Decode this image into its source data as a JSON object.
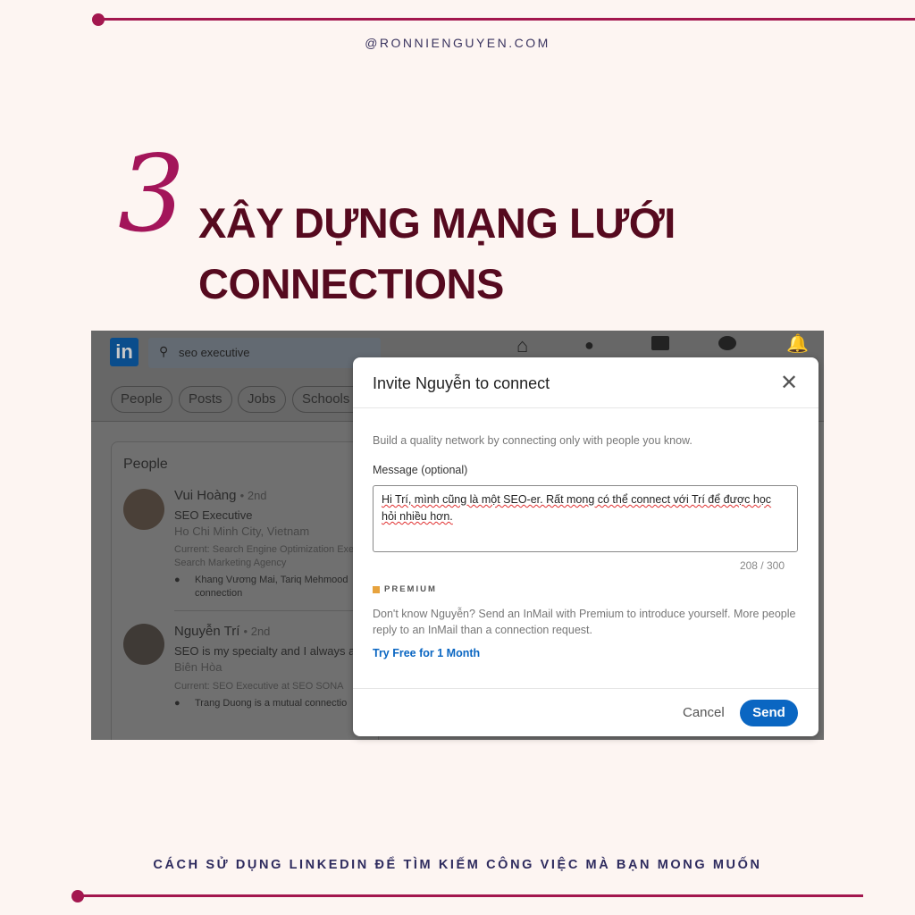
{
  "site": "@RONNIENGUYEN.COM",
  "step_number": "3",
  "title_line1": "XÂY DỰNG MẠNG LƯỚI",
  "title_line2": "CONNECTIONS",
  "footer": "CÁCH SỬ DỤNG LINKEDIN ĐỂ TÌM KIẾM CÔNG VIỆC MÀ BẠN MONG MUỐN",
  "colors": {
    "accent": "#a3174f",
    "title": "#560a1f",
    "linkedin_blue": "#0a66c2"
  },
  "linkedin": {
    "logo": "in",
    "search_value": "seo executive",
    "filters": [
      "People",
      "Posts",
      "Jobs",
      "Schools"
    ],
    "section_title": "People",
    "people": [
      {
        "name": "Vui Hoàng",
        "degree": "• 2nd",
        "headline": "SEO Executive",
        "location": "Ho Chi Minh City, Vietnam",
        "current": "Current: Search Engine Optimization Exe",
        "current2": "Search Marketing Agency",
        "mutual": "Khang Vương Mai, Tariq Mehmood",
        "mutual2": "connection"
      },
      {
        "name": "Nguyễn Trí",
        "degree": "• 2nd",
        "headline": "SEO is my specialty and I always ai",
        "location": "Biên Hòa",
        "current": "Current: SEO Executive at SEO SONA",
        "mutual": "Trang Duong is a mutual connectio"
      }
    ]
  },
  "modal": {
    "title": "Invite Nguyễn to connect",
    "intro": "Build a quality network by connecting only with people you know.",
    "message_label": "Message (optional)",
    "message_value": "Hi Trí, mình cũng là một SEO-er. Rất mong có thể connect với Trí để được học hỏi nhiều hơn.",
    "char_count": "208 / 300",
    "premium_label": "PREMIUM",
    "premium_text": "Don't know Nguyễn? Send an InMail with Premium to introduce yourself. More people reply to an InMail than a connection request.",
    "premium_link": "Try Free for 1 Month",
    "cancel": "Cancel",
    "send": "Send"
  }
}
